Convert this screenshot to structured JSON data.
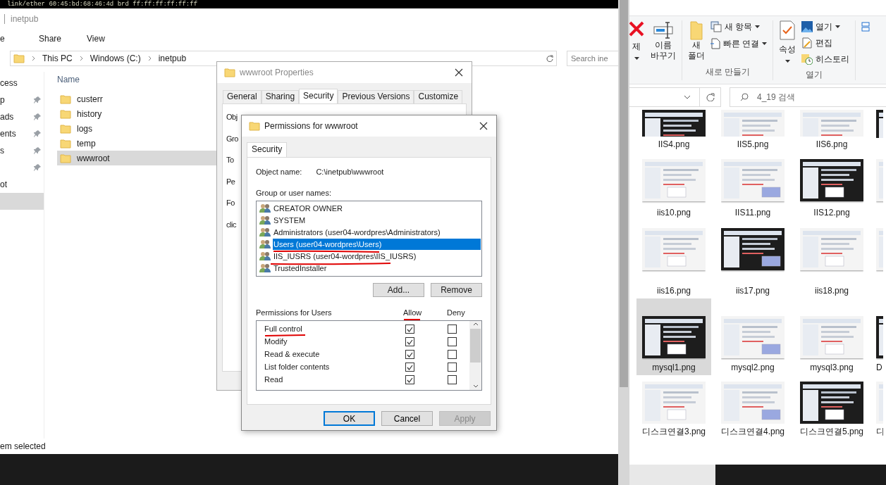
{
  "terminal": {
    "line": "link/ether 60:45:bd:68:46:4d brd ff:ff:ff:ff:ff:ff"
  },
  "explorer": {
    "title": "inetpub",
    "ribbon_tabs": [
      {
        "label": "e",
        "selected": false
      },
      {
        "label": "Share",
        "selected": false
      },
      {
        "label": "View",
        "selected": false
      }
    ],
    "breadcrumb": [
      "This PC",
      "Windows (C:)",
      "inetpub"
    ],
    "search": {
      "placeholder": "Search ine"
    },
    "nav_items": [
      {
        "label": "cess",
        "pinned": false,
        "selected": false
      },
      {
        "label": "p",
        "pinned": true,
        "selected": false
      },
      {
        "label": "ads",
        "pinned": true,
        "selected": false
      },
      {
        "label": "ents",
        "pinned": true,
        "selected": false
      },
      {
        "label": "s",
        "pinned": true,
        "selected": false
      },
      {
        "pinned": true,
        "selected": false
      },
      {
        "label": "ot",
        "pinned": false,
        "selected": false
      },
      {
        "pinned": false,
        "selected": true
      }
    ],
    "column": "Name",
    "files": [
      {
        "name": "custerr",
        "selected": false
      },
      {
        "name": "history",
        "selected": false
      },
      {
        "name": "logs",
        "selected": false
      },
      {
        "name": "temp",
        "selected": false
      },
      {
        "name": "wwwroot",
        "selected": true
      }
    ],
    "status": "em selected"
  },
  "properties": {
    "title": "wwwroot Properties",
    "tabs": [
      {
        "label": "General",
        "selected": false
      },
      {
        "label": "Sharing",
        "selected": false
      },
      {
        "label": "Security",
        "selected": true
      },
      {
        "label": "Previous Versions",
        "selected": false
      },
      {
        "label": "Customize",
        "selected": false
      }
    ],
    "fragments": [
      "Obj",
      "Gro",
      "To",
      "Pe",
      "Fo",
      "clic"
    ]
  },
  "permissions": {
    "title": "Permissions for wwwroot",
    "tab": "Security",
    "object_label": "Object name:",
    "object_value": "C:\\inetpub\\wwwroot",
    "group_label": "Group or user names:",
    "users": [
      {
        "name": "CREATOR OWNER",
        "selected": false
      },
      {
        "name": "SYSTEM",
        "selected": false
      },
      {
        "name": "Administrators (user04-wordpres\\Administrators)",
        "selected": false
      },
      {
        "name": "Users (user04-wordpres\\Users)",
        "selected": true
      },
      {
        "name": "IIS_IUSRS (user04-wordpres\\IIS_IUSRS)",
        "selected": false
      },
      {
        "name": "TrustedInstaller",
        "selected": false
      }
    ],
    "add_button": "Add...",
    "remove_button": "Remove",
    "perm_label": "Permissions for Users",
    "allow_label": "Allow",
    "deny_label": "Deny",
    "perms": [
      {
        "name": "Full control",
        "allow": true,
        "deny": false
      },
      {
        "name": "Modify",
        "allow": true,
        "deny": false
      },
      {
        "name": "Read & execute",
        "allow": true,
        "deny": false
      },
      {
        "name": "List folder contents",
        "allow": true,
        "deny": false
      },
      {
        "name": "Read",
        "allow": true,
        "deny": false
      }
    ],
    "buttons": [
      {
        "label": "OK",
        "kind": "default",
        "disabled": false
      },
      {
        "label": "Cancel",
        "kind": "normal",
        "disabled": false
      },
      {
        "label": "Apply",
        "kind": "normal",
        "disabled": true
      }
    ]
  },
  "gallery": {
    "ribbon": {
      "delete": "제",
      "rename": [
        "이름",
        "바꾸기"
      ],
      "new_folder": [
        "새",
        "폴더"
      ],
      "new_item": "새 항목",
      "quick_link": "빠른 연결",
      "new_group": "새로 만들기",
      "properties": "속성",
      "open": "열기",
      "edit": "편집",
      "history": "히스토리",
      "open_group": "열기"
    },
    "search": {
      "placeholder": "4_19 검색"
    },
    "rows": [
      [
        {
          "name": "IIS4.png",
          "selected": false
        },
        {
          "name": "IIS5.png",
          "selected": false
        },
        {
          "name": "IIS6.png",
          "selected": false
        },
        {
          "selected": false
        }
      ],
      [
        {
          "name": "iis10.png",
          "selected": false
        },
        {
          "name": "IIS11.png",
          "selected": false
        },
        {
          "name": "IIS12.png",
          "selected": false
        },
        {
          "selected": false
        }
      ],
      [
        {
          "name": "iis16.png",
          "selected": false
        },
        {
          "name": "iis17.png",
          "selected": false
        },
        {
          "name": "iis18.png",
          "selected": false
        },
        {
          "selected": false
        }
      ],
      [
        {
          "name": "mysql1.png",
          "selected": true
        },
        {
          "name": "mysql2.png",
          "selected": false
        },
        {
          "name": "mysql3.png",
          "selected": false
        },
        {
          "name": "D",
          "selected": false
        }
      ],
      [
        {
          "name": "디스크연결3.png",
          "selected": false
        },
        {
          "name": "디스크연결4.png",
          "selected": false
        },
        {
          "name": "디스크연결5.png",
          "selected": false
        },
        {
          "name": "디",
          "selected": false
        }
      ]
    ]
  }
}
